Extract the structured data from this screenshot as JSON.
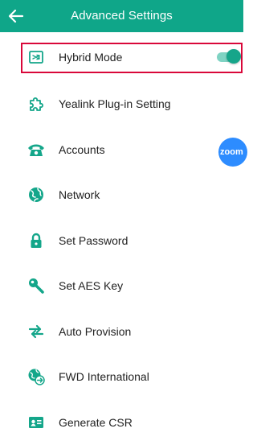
{
  "header": {
    "title": "Advanced Settings",
    "back_icon": "arrow-left-icon",
    "background_color": "#0fa689"
  },
  "items": [
    {
      "label": "Hybrid Mode",
      "icon": "hybrid-mode-icon",
      "toggle_on": true,
      "highlighted": true
    },
    {
      "label": "Yealink Plug-in Setting",
      "icon": "puzzle-icon"
    },
    {
      "label": "Accounts",
      "icon": "phone-icon"
    },
    {
      "label": "Network",
      "icon": "globe-icon"
    },
    {
      "label": "Set Password",
      "icon": "lock-icon"
    },
    {
      "label": "Set AES Key",
      "icon": "key-icon"
    },
    {
      "label": "Auto Provision",
      "icon": "sync-arrows-icon"
    },
    {
      "label": "FWD International",
      "icon": "forward-globe-icon"
    },
    {
      "label": "Generate CSR",
      "icon": "id-card-icon"
    }
  ],
  "floating_badge": {
    "text": "zoom",
    "color": "#2d8cff"
  },
  "accent_color": "#0fa689",
  "highlight_color": "#d9083a"
}
